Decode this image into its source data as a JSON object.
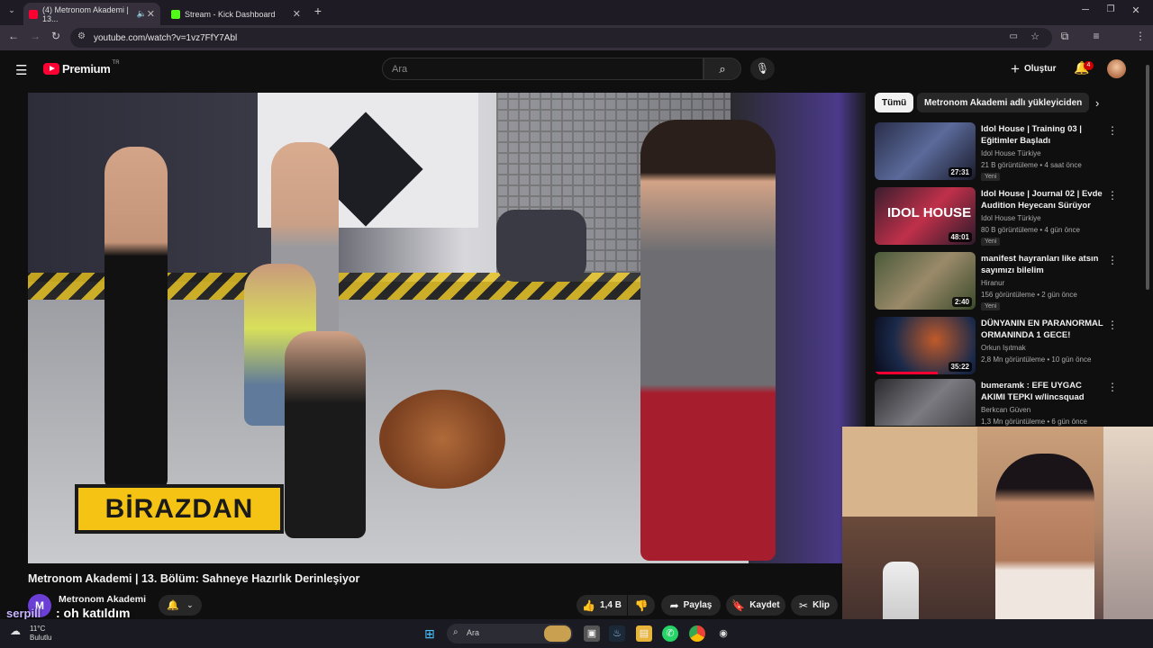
{
  "browser": {
    "tabs": [
      {
        "title": "(4) Metronom Akademi | 13...",
        "active": true,
        "favicon_color": "#ff0033"
      },
      {
        "title": "Stream - Kick Dashboard",
        "active": false,
        "favicon_color": "#53fc18"
      }
    ],
    "new_tab": "+",
    "url": "youtube.com/watch?v=1vz7FfY7Abl"
  },
  "youtube": {
    "logo_text": "Premium",
    "logo_sup": "TR",
    "search_placeholder": "Ara",
    "create_label": "Oluştur",
    "notification_count": "4",
    "chips": [
      "Tümü",
      "Metronom Akademi adlı yükleyiciden"
    ],
    "video": {
      "caption": "BİRAZDAN",
      "title": "Metronom Akademi | 13. Bölüm: Sahneye Hazırlık Derinleşiyor",
      "channel": "Metronom Akademi",
      "channel_initial": "M",
      "likes": "1,4 B",
      "share_label": "Paylaş",
      "save_label": "Kaydet",
      "clip_label": "Klip"
    },
    "recommendations": [
      {
        "title": "Idol House | Training 03 | Eğitimler Başladı",
        "channel": "Idol House Türkiye",
        "meta": "21 B görüntüleme • 4 saat önce",
        "badge": "Yeni",
        "duration": "27:31"
      },
      {
        "title": "Idol House | Journal 02 | Evde Audition Heyecanı Sürüyor",
        "channel": "Idol House Türkiye",
        "meta": "80 B görüntüleme • 4 gün önce",
        "badge": "Yeni",
        "duration": "48:01"
      },
      {
        "title": "manifest hayranları like atsın sayımızı bilelim",
        "channel": "Hiranur",
        "meta": "156 görüntüleme • 2 gün önce",
        "badge": "Yeni",
        "duration": "2:40"
      },
      {
        "title": "DÜNYANIN EN PARANORMAL ORMANINDA 1 GECE!",
        "channel": "Orkun Işıtmak",
        "meta": "2,8 Mn görüntüleme • 10 gün önce",
        "badge": "",
        "duration": "35:22"
      },
      {
        "title": "bumeramk : EFE UYGAC AKIMI TEPKI w/lincsquad",
        "channel": "Berkcan Güven",
        "meta": "1,3 Mn görüntüleme • 6 gün önce",
        "badge": "",
        "duration": ""
      }
    ]
  },
  "chat_overlay": {
    "user": "serpill",
    "message": ": oh katıldım"
  },
  "taskbar": {
    "weather_temp": "11°C",
    "weather_desc": "Bulutlu",
    "search_placeholder": "Ara"
  }
}
